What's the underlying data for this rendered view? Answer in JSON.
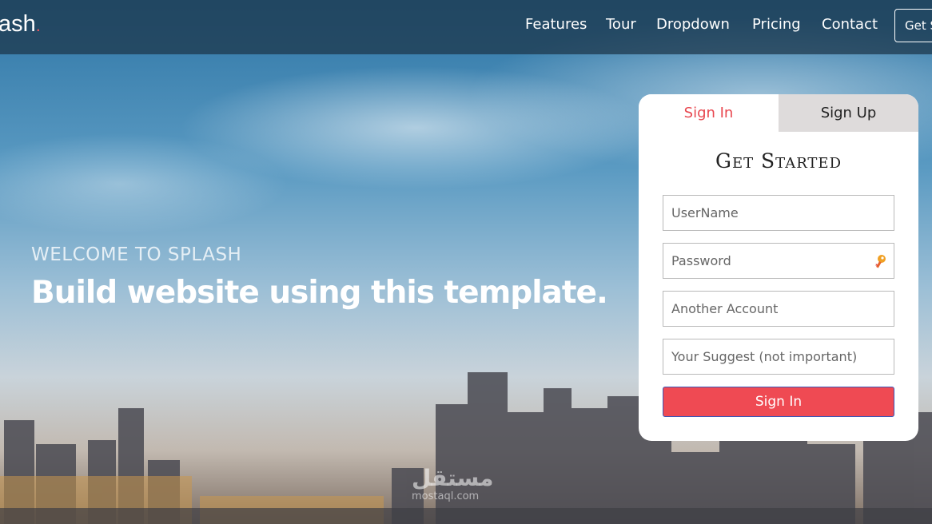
{
  "nav": {
    "brand": "ash",
    "brand_dot": ".",
    "links": [
      "Features",
      "Tour",
      "Dropdown",
      "Pricing",
      "Contact"
    ],
    "cta": "Get S"
  },
  "hero": {
    "welcome": "WELCOME TO SPLASH",
    "headline": "Build website using this template."
  },
  "panel": {
    "tabs": {
      "signin": "Sign In",
      "signup": "Sign Up"
    },
    "title": "Get Started",
    "fields": {
      "username_placeholder": "UserName",
      "password_placeholder": "Password",
      "another_account_placeholder": "Another Account",
      "suggest_placeholder": "Your Suggest (not important)"
    },
    "submit": "Sign In"
  },
  "watermark": {
    "arabic": "مستقل",
    "latin": "mostaql.com"
  },
  "colors": {
    "accent": "#ef4a53",
    "tab_active_text": "#e8474f",
    "button_border": "#3b55b6"
  }
}
